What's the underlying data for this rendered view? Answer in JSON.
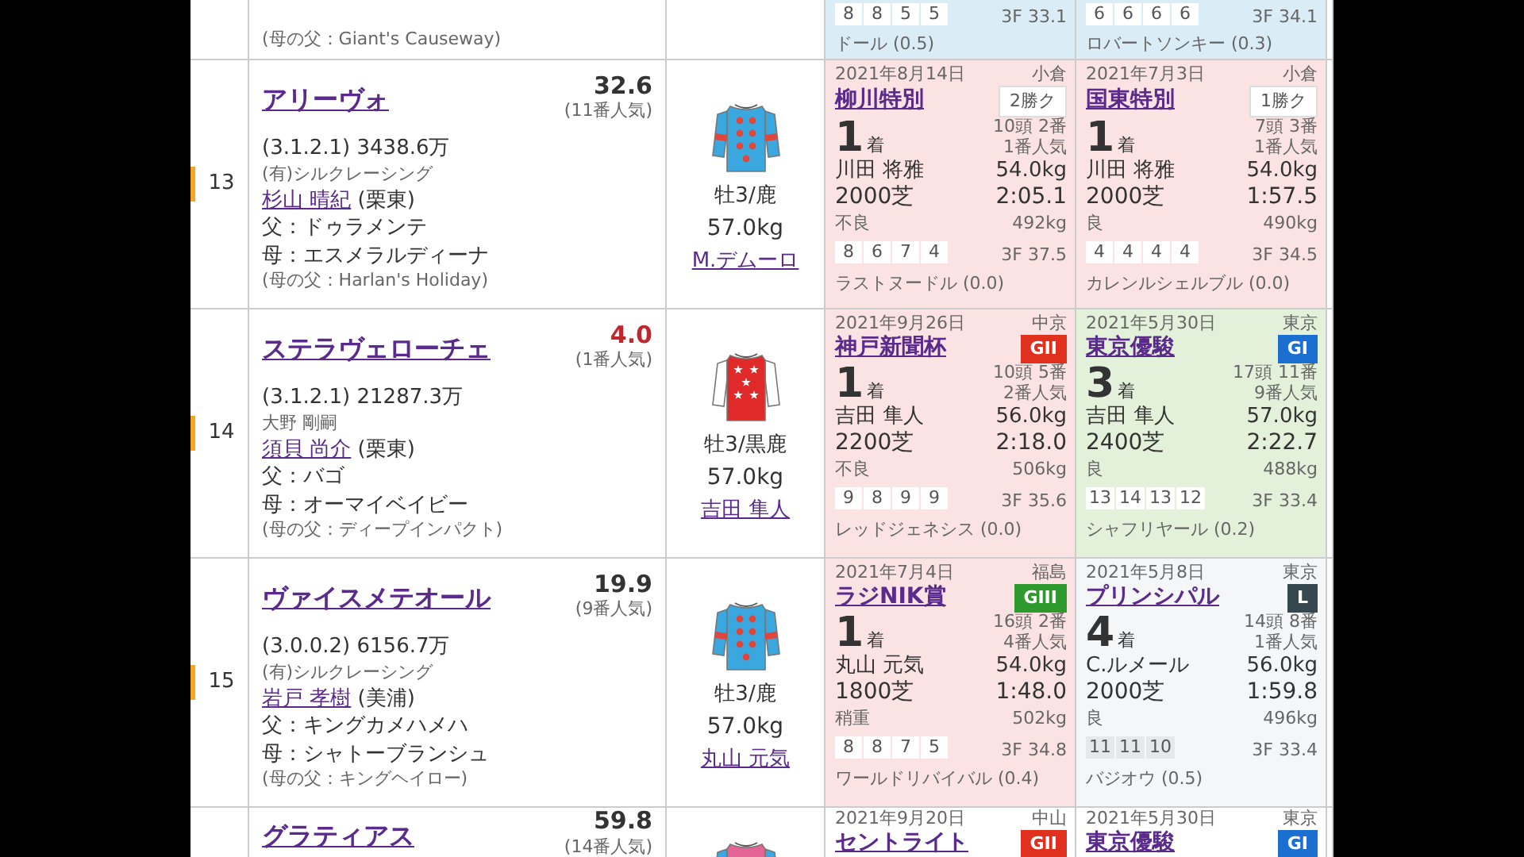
{
  "top_partial_row": {
    "dam_sire": "(母の父：Giant's Causeway)",
    "races": [
      {
        "color": "#daedf7",
        "passing": [
          "8",
          "8",
          "5",
          "5"
        ],
        "last_3f": "3F 33.1",
        "winner": "ドール (0.5)"
      },
      {
        "color": "#daedf7",
        "passing": [
          "6",
          "6",
          "6",
          "6"
        ],
        "last_3f": "3F 34.1",
        "winner": "ロバートソンキー (0.3)"
      }
    ]
  },
  "entries": [
    {
      "number": "13",
      "marker": {
        "color": "#f5a623"
      },
      "name": "アリーヴォ",
      "odds": "32.6",
      "odds_favorite": false,
      "popularity": "(11番人気)",
      "record": "(3.1.2.1) 3438.6万",
      "owner": "(有)シルクレーシング",
      "trainer": "杉山 晴紀",
      "trainer_region": "(栗東)",
      "sire": "父：ドゥラメンテ",
      "dam": "母：エスメラルディーナ",
      "dam_sire": "(母の父：Harlan's Holiday)",
      "silks": {
        "kind": "dots"
      },
      "sex_age": "牡3/鹿",
      "weight": "57.0kg",
      "jockey": "M.デムーロ",
      "races": [
        {
          "color": "#fbe3e3",
          "date": "2021年8月14日",
          "venue": "小倉",
          "race_name": "柳川特別",
          "grade": {
            "label": "2勝ク",
            "kind": "class"
          },
          "finish": "**1**着",
          "field": "10頭 2番",
          "popularity": "1番人気",
          "jockey": "川田 将雅",
          "weight": "54.0kg",
          "distance": "2000芝",
          "time": "2:05.1",
          "condition": "不良",
          "horse_weight": "492kg",
          "passing": [
            "8",
            "6",
            "7",
            "4"
          ],
          "last_3f": "3F 37.5",
          "winner": "ラストヌードル (0.0)"
        },
        {
          "color": "#fbe3e3",
          "date": "2021年7月3日",
          "venue": "小倉",
          "race_name": "国東特別",
          "grade": {
            "label": "1勝ク",
            "kind": "class"
          },
          "finish": "**1**着",
          "field": "7頭 3番",
          "popularity": "1番人気",
          "jockey": "川田 将雅",
          "weight": "54.0kg",
          "distance": "2000芝",
          "time": "1:57.5",
          "condition": "良",
          "horse_weight": "490kg",
          "passing": [
            "4",
            "4",
            "4",
            "4"
          ],
          "last_3f": "3F 34.5",
          "winner": "カレンルシェルブル (0.0)"
        }
      ]
    },
    {
      "number": "14",
      "marker": {
        "color": "#f5a623"
      },
      "name": "ステラヴェローチェ",
      "odds": "4.0",
      "odds_favorite": true,
      "popularity": "(1番人気)",
      "record": "(3.1.2.1) 21287.3万",
      "owner": "大野 剛嗣",
      "trainer": "須貝 尚介",
      "trainer_region": "(栗東)",
      "sire": "父：バゴ",
      "dam": "母：オーマイベイビー",
      "dam_sire": "(母の父：ディープインパクト)",
      "silks": {
        "kind": "stars"
      },
      "sex_age": "牡3/黒鹿",
      "weight": "57.0kg",
      "jockey": "吉田 隼人",
      "races": [
        {
          "color": "#fbe3e3",
          "date": "2021年9月26日",
          "venue": "中京",
          "race_name": "神戸新聞杯",
          "grade": {
            "label": "GII",
            "kind": "g2"
          },
          "finish": "**1**着",
          "field": "10頭 5番",
          "popularity": "2番人気",
          "jockey": "吉田 隼人",
          "weight": "56.0kg",
          "distance": "2200芝",
          "time": "2:18.0",
          "condition": "不良",
          "horse_weight": "506kg",
          "passing": [
            "9",
            "8",
            "9",
            "9"
          ],
          "last_3f": "3F 35.6",
          "winner": "レッドジェネシス (0.0)"
        },
        {
          "color": "#e3f1da",
          "date": "2021年5月30日",
          "venue": "東京",
          "race_name": "東京優駿",
          "grade": {
            "label": "GI",
            "kind": "g1"
          },
          "finish": "**3**着",
          "field": "17頭 11番",
          "popularity": "9番人気",
          "jockey": "吉田 隼人",
          "weight": "57.0kg",
          "distance": "2400芝",
          "time": "2:22.7",
          "condition": "良",
          "horse_weight": "488kg",
          "passing": [
            "13",
            "14",
            "13",
            "12"
          ],
          "last_3f": "3F 33.4",
          "winner": "シャフリヤール (0.2)"
        }
      ]
    },
    {
      "number": "15",
      "marker": {
        "color": "#f5a623"
      },
      "name": "ヴァイスメテオール",
      "odds": "19.9",
      "odds_favorite": false,
      "popularity": "(9番人気)",
      "record": "(3.0.0.2) 6156.7万",
      "owner": "(有)シルクレーシング",
      "trainer": "岩戸 孝樹",
      "trainer_region": "(美浦)",
      "sire": "父：キングカメハメハ",
      "dam": "母：シャトーブランシュ",
      "dam_sire": "(母の父：キングヘイロー)",
      "silks": {
        "kind": "dots"
      },
      "sex_age": "牡3/鹿",
      "weight": "57.0kg",
      "jockey": "丸山 元気",
      "races": [
        {
          "color": "#fbe3e3",
          "date": "2021年7月4日",
          "venue": "福島",
          "race_name": "ラジNIK賞",
          "grade": {
            "label": "GIII",
            "kind": "g3"
          },
          "finish": "**1**着",
          "field": "16頭 2番",
          "popularity": "4番人気",
          "jockey": "丸山 元気",
          "weight": "54.0kg",
          "distance": "1800芝",
          "time": "1:48.0",
          "condition": "稍重",
          "horse_weight": "502kg",
          "passing": [
            "8",
            "8",
            "7",
            "5"
          ],
          "last_3f": "3F 34.8",
          "winner": "ワールドリバイバル (0.4)"
        },
        {
          "color": "#f4f6f7",
          "date": "2021年5月8日",
          "venue": "東京",
          "race_name": "プリンシパル",
          "grade": {
            "label": "L",
            "kind": "listed"
          },
          "finish": "**4**着",
          "field": "14頭 8番",
          "popularity": "1番人気",
          "jockey": "C.ルメール",
          "weight": "56.0kg",
          "distance": "2000芝",
          "time": "1:59.8",
          "condition": "良",
          "horse_weight": "496kg",
          "passing": [
            "11",
            "11",
            "10"
          ],
          "last_3f": "3F 33.4",
          "winner": "バジオウ (0.5)"
        }
      ]
    }
  ],
  "partial_entry": {
    "name": "グラティアス",
    "odds": "59.8",
    "odds_favorite": false,
    "popularity": "(14番人気)",
    "silks": {
      "kind": "pink"
    },
    "races": [
      {
        "date": "2021年9月20日",
        "venue": "中山",
        "race_name": "セントライト",
        "grade": {
          "label": "GII",
          "kind": "g2"
        }
      },
      {
        "date": "2021年5月30日",
        "venue": "東京",
        "race_name": "東京優駿",
        "grade": {
          "label": "GI",
          "kind": "g1"
        }
      }
    ]
  }
}
